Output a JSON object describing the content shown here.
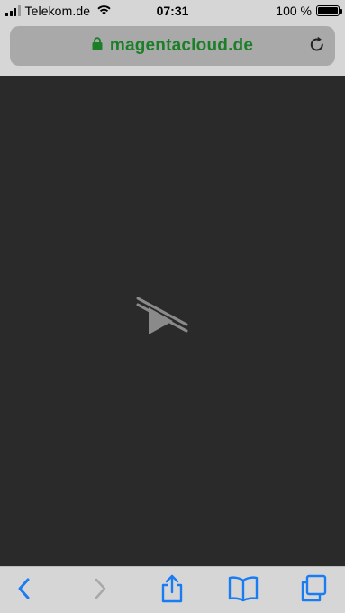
{
  "status_bar": {
    "carrier": "Telekom.de",
    "time": "07:31",
    "battery_percent_text": "100 %",
    "battery_level": 1.0,
    "signal_bars_filled": 3,
    "signal_bars_total": 4
  },
  "address_bar": {
    "url": "magentacloud.de",
    "secure_icon": "lock-icon",
    "reload_icon": "reload-icon",
    "url_color": "#1b7f27"
  },
  "content": {
    "state_icon": "video-disabled-play-icon",
    "background": "#2a2a2a"
  },
  "bottom_toolbar": {
    "accent": "#1a7cf2",
    "disabled": "#a8a8a8",
    "buttons": [
      {
        "name": "back",
        "icon": "chevron-left-icon",
        "enabled": true
      },
      {
        "name": "forward",
        "icon": "chevron-right-icon",
        "enabled": false
      },
      {
        "name": "share",
        "icon": "share-icon",
        "enabled": true
      },
      {
        "name": "bookmarks",
        "icon": "book-icon",
        "enabled": true
      },
      {
        "name": "tabs",
        "icon": "tabs-icon",
        "enabled": true
      }
    ]
  }
}
